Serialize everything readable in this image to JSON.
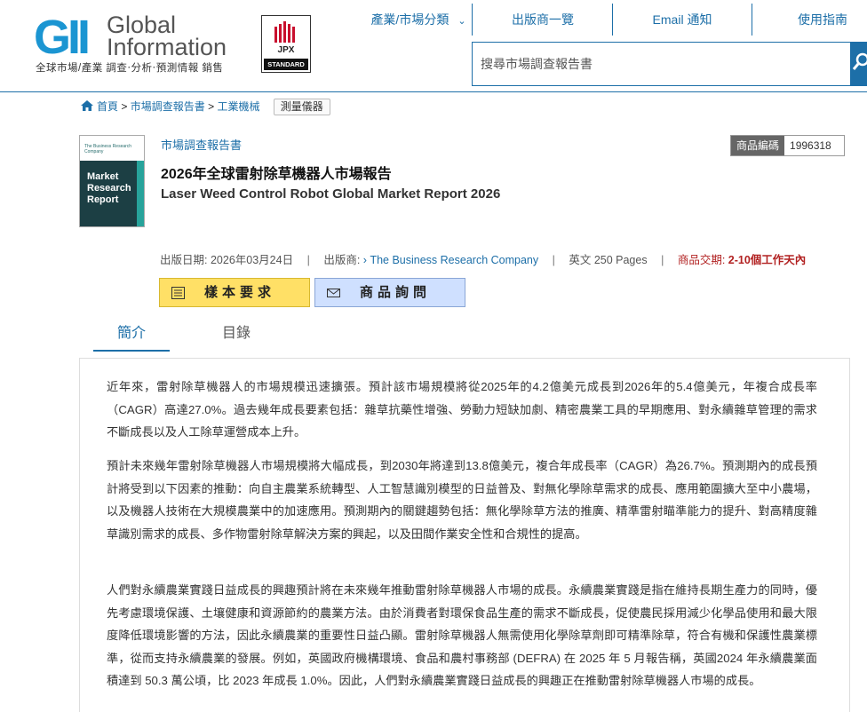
{
  "header": {
    "logo_mark": "GII",
    "logo_line1": "Global",
    "logo_line2": "Information",
    "logo_tagline": "全球市場/產業 調查‧分析‧預測情報 銷售",
    "jpx_label": "JPX",
    "jpx_sub": "STANDARD",
    "nav": [
      {
        "label": "產業/市場分類"
      },
      {
        "label": "出版商一覽"
      },
      {
        "label": "Email 通知"
      },
      {
        "label": "使用指南"
      }
    ],
    "search_placeholder": "搜尋市場調查報告書"
  },
  "breadcrumb": {
    "home": "首頁",
    "sep": ">",
    "level1": "市場調查報告書",
    "level2": "工業機械",
    "tag": "測量儀器"
  },
  "product": {
    "cover_brand": "The Business Research Company",
    "cover_title": "Market Research Report",
    "kind": "市場調查報告書",
    "title_zh": "2026年全球雷射除草機器人市場報告",
    "title_en": "Laser Weed Control Robot Global Market Report 2026",
    "code_label": "商品編碼",
    "code_value": "1996318",
    "pub_date_label": "出版日期:",
    "pub_date": "2026年03月24日",
    "publisher_label": "出版商:",
    "publisher": "The Business Research Company",
    "pages": "英文 250 Pages",
    "delivery_label": "商品交期:",
    "delivery": "2-10個工作天內",
    "sample_button": "樣本要求",
    "inquiry_button": "商品詢問"
  },
  "tabs": {
    "summary": "簡介",
    "toc": "目錄"
  },
  "content": {
    "p1": "近年來，雷射除草機器人的市場規模迅速擴張。預計該市場規模將從2025年的4.2億美元成長到2026年的5.4億美元，年複合成長率（CAGR）高達27.0%。過去幾年成長要素包括：雜草抗藥性增強、勞動力短缺加劇、精密農業工具的早期應用、對永續雜草管理的需求不斷成長以及人工除草運營成本上升。",
    "p2": "預計未來幾年雷射除草機器人市場規模將大幅成長，到2030年將達到13.8億美元，複合年成長率（CAGR）為26.7%。預測期內的成長預計將受到以下因素的推動：向自主農業系統轉型、人工智慧識別模型的日益普及、對無化學除草需求的成長、應用範圍擴大至中小農場，以及機器人技術在大規模農業中的加速應用。預測期內的關鍵趨勢包括：無化學除草方法的推廣、精準雷射瞄準能力的提升、對高精度雜草識別需求的成長、多作物雷射除草解決方案的興起，以及田間作業安全性和合規性的提高。",
    "p3": "人們對永續農業實踐日益成長的興趣預計將在未來幾年推動雷射除草機器人市場的成長。永續農業實踐是指在維持長期生產力的同時，優先考慮環境保護、土壤健康和資源節約的農業方法。由於消費者對環保食品生產的需求不斷成長，促使農民採用減少化學品使用和最大限度降低環境影響的方法，因此永續農業的重要性日益凸顯。雷射除草機器人無需使用化學除草劑即可精準除草，符合有機和保護性農業標準，從而支持永續農業的發展。例如，英國政府機構環境、食品和農村事務部 (DEFRA) 在 2025 年 5 月報告稱，英國2024 年永續農業面積達到 50.3 萬公頃，比 2023 年成長 1.0%。因此，人們對永續農業實踐日益成長的興趣正在推動雷射除草機器人市場的成長。"
  },
  "colors": {
    "brand_blue": "#1d6fa8",
    "logo_blue": "#1b95d2",
    "sample_yellow": "#ffe066",
    "inquiry_blue": "#cfe0ff",
    "delivery_red": "#b22222"
  }
}
